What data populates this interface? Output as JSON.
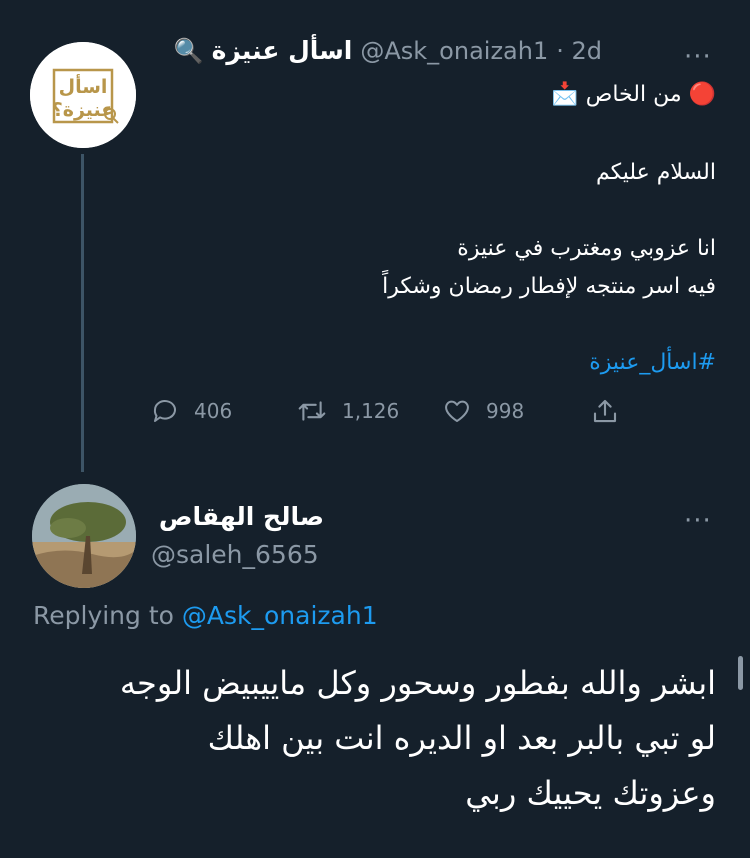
{
  "tweet": {
    "author_name": "اسأل عنيزة",
    "name_emoji": "🔍",
    "handle": "@Ask_onaizah1",
    "time": "· 2d",
    "more_label": "···",
    "avatar_logo_text": "اسأل عنيزة",
    "line1": "🔴 من الخاص 📩",
    "line2": "السلام عليكم",
    "line3": "انا عزوبي ومغترب في عنيزة",
    "line4": "فيه اسر منتجه لإفطار رمضان وشكراً",
    "hashtag": "#اسأل_عنيزة",
    "replies": "406",
    "retweets": "1,126",
    "likes": "998",
    "accent": "#1d9bf0"
  },
  "reply": {
    "author_name": "صالح الهقاص",
    "handle": "@saleh_6565",
    "more_label": "···",
    "replying_prefix": "Replying to",
    "replying_handle": "@Ask_onaizah1",
    "line1": "ابشر والله بفطور وسحور  وكل ماييبيض الوجه",
    "line2": "لو تبي بالبر بعد او الديره انت بين اهلك",
    "line3": "وعزوتك يحييك ربي"
  },
  "colors": {
    "background": "#15202b",
    "secondary_text": "#8b98a5",
    "logo_gold": "#b8964a"
  }
}
